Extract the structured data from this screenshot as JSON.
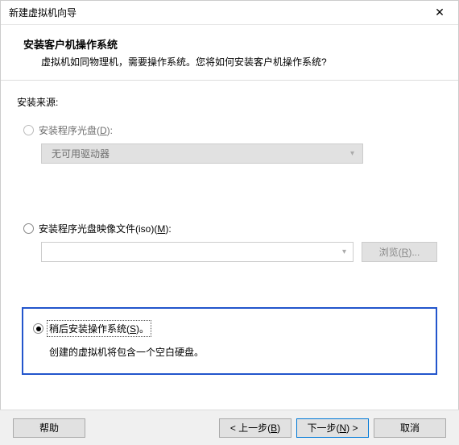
{
  "window": {
    "title": "新建虚拟机向导"
  },
  "header": {
    "heading": "安装客户机操作系统",
    "subheading": "虚拟机如同物理机，需要操作系统。您将如何安装客户机操作系统?"
  },
  "source_label": "安装来源:",
  "options": {
    "disc": {
      "label_pre": "安装程序光盘(",
      "shortcut": "D",
      "label_post": "):",
      "combo_text": "无可用驱动器"
    },
    "iso": {
      "label_pre": "安装程序光盘映像文件(iso)(",
      "shortcut": "M",
      "label_post": "):",
      "browse_pre": "浏览(",
      "browse_shortcut": "R",
      "browse_post": ")..."
    },
    "later": {
      "label_pre": "稍后安装操作系统(",
      "shortcut": "S",
      "label_post": ")。",
      "hint": "创建的虚拟机将包含一个空白硬盘。"
    }
  },
  "footer": {
    "help": "帮助",
    "back_pre": "< 上一步(",
    "back_shortcut": "B",
    "back_post": ")",
    "next_pre": "下一步(",
    "next_shortcut": "N",
    "next_post": ") >",
    "cancel": "取消"
  }
}
